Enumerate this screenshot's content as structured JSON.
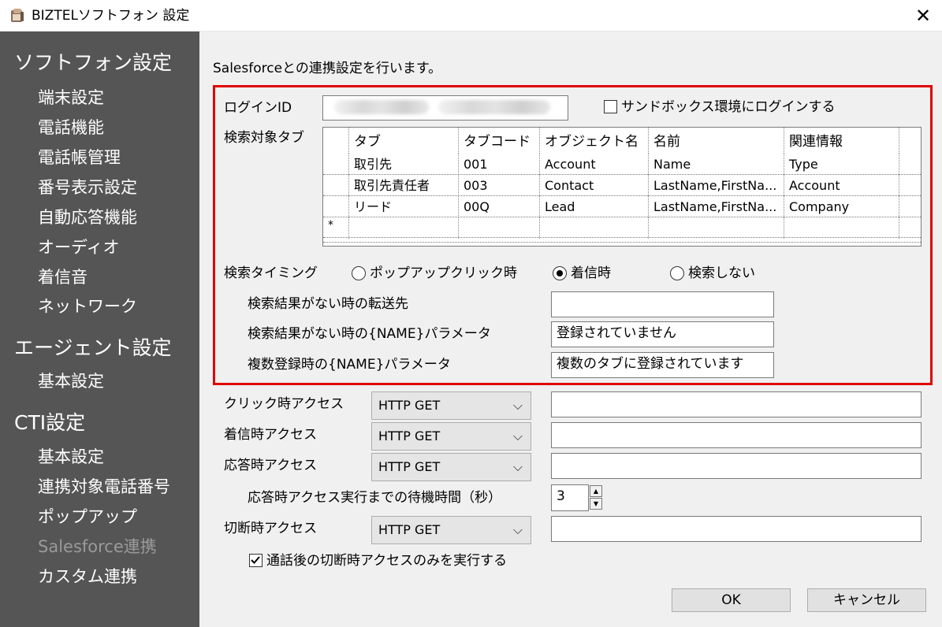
{
  "window": {
    "title": "BIZTELソフトフォン 設定",
    "close_glyph": "✕"
  },
  "sidebar": {
    "sections": [
      {
        "label": "ソフトフォン設定",
        "items": [
          "端末設定",
          "電話機能",
          "電話帳管理",
          "番号表示設定",
          "自動応答機能",
          "オーディオ",
          "着信音",
          "ネットワーク"
        ]
      },
      {
        "label": "エージェント設定",
        "items": [
          "基本設定"
        ]
      },
      {
        "label": "CTI設定",
        "items": [
          "基本設定",
          "連携対象電話番号",
          "ポップアップ",
          "Salesforce連携",
          "カスタム連携"
        ]
      }
    ],
    "disabled_item": "Salesforce連携"
  },
  "main": {
    "intro": "Salesforceとの連携設定を行います。",
    "login_id_label": "ログインID",
    "sandbox_label": "サンドボックス環境にログインする",
    "sandbox_checked": false,
    "search_tab_label": "検索対象タブ",
    "grid": {
      "headers": [
        "タブ",
        "タブコード",
        "オブジェクト名",
        "名前",
        "関連情報"
      ],
      "rows": [
        [
          "取引先",
          "001",
          "Account",
          "Name",
          "Type"
        ],
        [
          "取引先責任者",
          "003",
          "Contact",
          "LastName,FirstNa...",
          "Account"
        ],
        [
          "リード",
          "00Q",
          "Lead",
          "LastName,FirstNa...",
          "Company"
        ]
      ],
      "new_row_marker": "*"
    },
    "search_timing": {
      "label": "検索タイミング",
      "options": [
        "ポップアップクリック時",
        "着信時",
        "検索しない"
      ],
      "selected": "着信時"
    },
    "no_result_forward": {
      "label": "検索結果がない時の転送先",
      "value": ""
    },
    "no_result_name": {
      "label": "検索結果がない時の{NAME}パラメータ",
      "value": "登録されていません"
    },
    "multi_name": {
      "label": "複数登録時の{NAME}パラメータ",
      "value": "複数のタブに登録されています"
    },
    "access": [
      {
        "label": "クリック時アクセス",
        "method": "HTTP GET",
        "url": ""
      },
      {
        "label": "着信時アクセス",
        "method": "HTTP GET",
        "url": ""
      },
      {
        "label": "応答時アクセス",
        "method": "HTTP GET",
        "url": ""
      }
    ],
    "wait": {
      "label": "応答時アクセス実行までの待機時間（秒）",
      "value": "3"
    },
    "disconnect": {
      "label": "切断時アクセス",
      "method": "HTTP GET",
      "url": ""
    },
    "after_call_only": {
      "label": "通話後の切断時アクセスのみを実行する",
      "checked": true
    },
    "ok_label": "OK",
    "cancel_label": "キャンセル"
  },
  "colors": {
    "sidebar_bg": "#555555",
    "content_bg": "#f0f0f0",
    "highlight_border": "#e00000",
    "disabled_text": "#9a9a9a"
  }
}
